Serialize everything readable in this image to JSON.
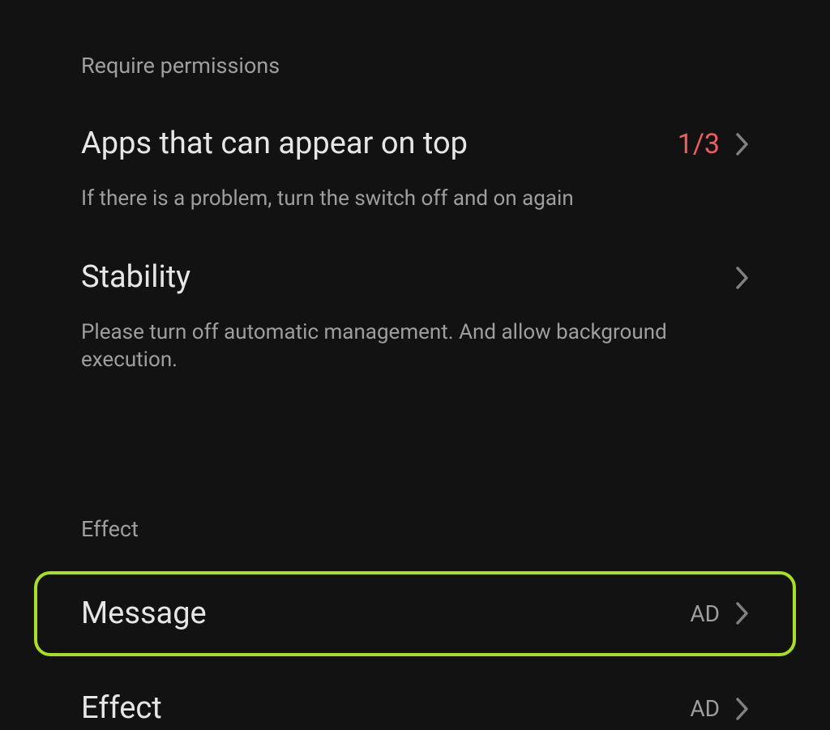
{
  "sections": {
    "permissions": {
      "header": "Require permissions",
      "items": [
        {
          "title": "Apps that can appear on top",
          "subtitle": "If there is a problem, turn the switch off and on again",
          "value": "1/3"
        },
        {
          "title": "Stability",
          "subtitle": "Please turn off automatic management. And allow background execution."
        }
      ]
    },
    "effect": {
      "header": "Effect",
      "items": [
        {
          "title": "Message",
          "value": "AD"
        },
        {
          "title": "Effect",
          "value": "AD"
        }
      ]
    }
  }
}
